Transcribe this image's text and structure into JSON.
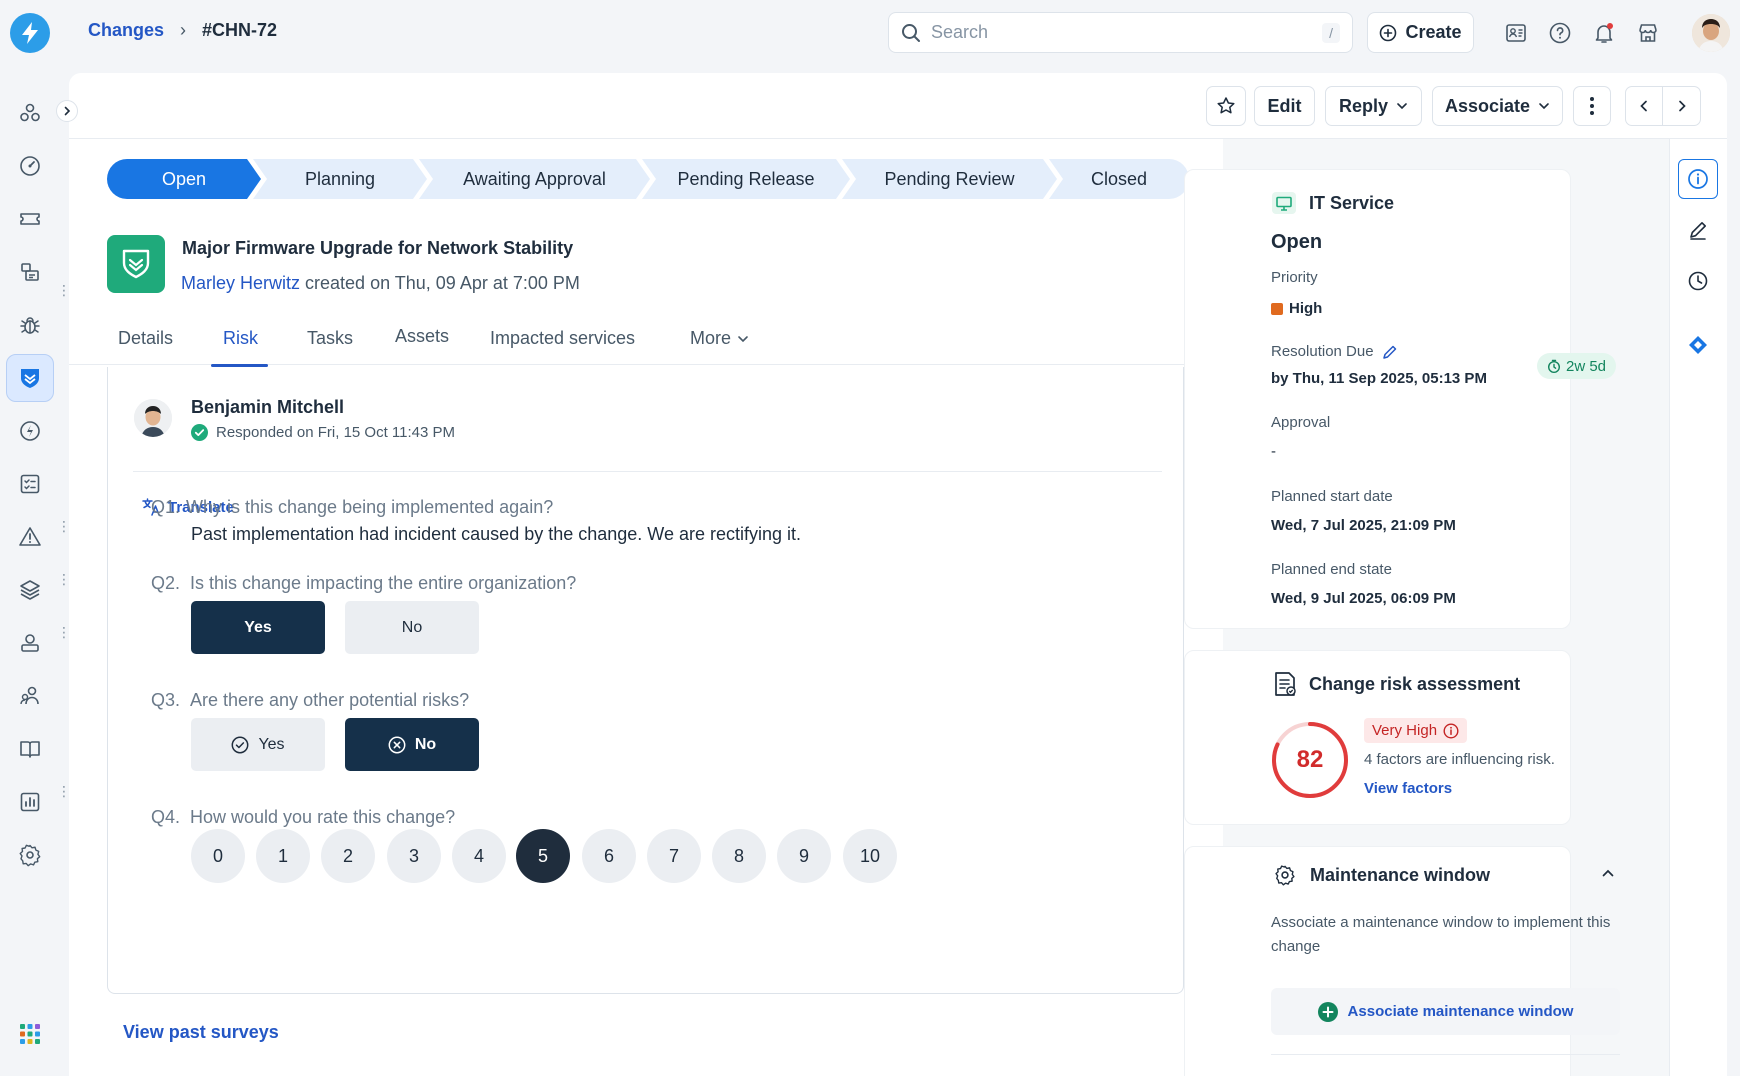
{
  "breadcrumb": {
    "parent": "Changes",
    "current": "#CHN-72"
  },
  "search": {
    "placeholder": "Search",
    "shortcut": "/"
  },
  "header_actions": {
    "create": "Create"
  },
  "toolbar": {
    "edit": "Edit",
    "reply": "Reply",
    "associate": "Associate"
  },
  "steps": [
    "Open",
    "Planning",
    "Awaiting Approval",
    "Pending Release",
    "Pending Review",
    "Closed"
  ],
  "ticket": {
    "title": "Major Firmware Upgrade for Network Stability",
    "author": "Marley Herwitz",
    "meta": "created on Thu, 09 Apr at 7:00 PM"
  },
  "tabs": [
    "Details",
    "Risk",
    "Tasks",
    "Assets",
    "Impacted services",
    "More"
  ],
  "survey": {
    "respondent": "Benjamin Mitchell",
    "status": "Responded on Fri, 15 Oct 11:43 PM",
    "translate": "Translate",
    "q1": {
      "num": "Q1.",
      "text": "Why is this change being implemented again?",
      "answer": "Past implementation had incident caused by the change. We are rectifying it."
    },
    "q2": {
      "num": "Q2.",
      "text": "Is this change impacting the entire organization?",
      "yes": "Yes",
      "no": "No"
    },
    "q3": {
      "num": "Q3.",
      "text": "Are there any other potential risks?",
      "yes": "Yes",
      "no": "No"
    },
    "q4": {
      "num": "Q4.",
      "text": "How would you rate this change?",
      "ratings": [
        "0",
        "1",
        "2",
        "3",
        "4",
        "5",
        "6",
        "7",
        "8",
        "9",
        "10"
      ],
      "selected": 5
    },
    "past": "View past surveys"
  },
  "properties": {
    "service": "IT Service",
    "status": "Open",
    "priority_label": "Priority",
    "priority": "High",
    "due_label": "Resolution Due",
    "due": "by Thu, 11 Sep 2025, 05:13 PM",
    "due_badge": "2w 5d",
    "approval_label": "Approval",
    "approval": "-",
    "start_label": "Planned start date",
    "start": "Wed, 7 Jul 2025, 21:09 PM",
    "end_label": "Planned end state",
    "end": "Wed, 9 Jul 2025, 06:09 PM"
  },
  "risk": {
    "title": "Change risk assessment",
    "score": "82",
    "level": "Very High",
    "factors": "4 factors are influencing risk.",
    "view": "View factors"
  },
  "maintenance": {
    "title": "Maintenance window",
    "desc": "Associate a maintenance window to implement this change",
    "action": "Associate maintenance window"
  },
  "colors": {
    "primary": "#1976e3",
    "link": "#2457c5",
    "dark": "#15304a",
    "risk": "#e03c3c",
    "priority_high": "#e06a1f",
    "green": "#1faa7b"
  }
}
